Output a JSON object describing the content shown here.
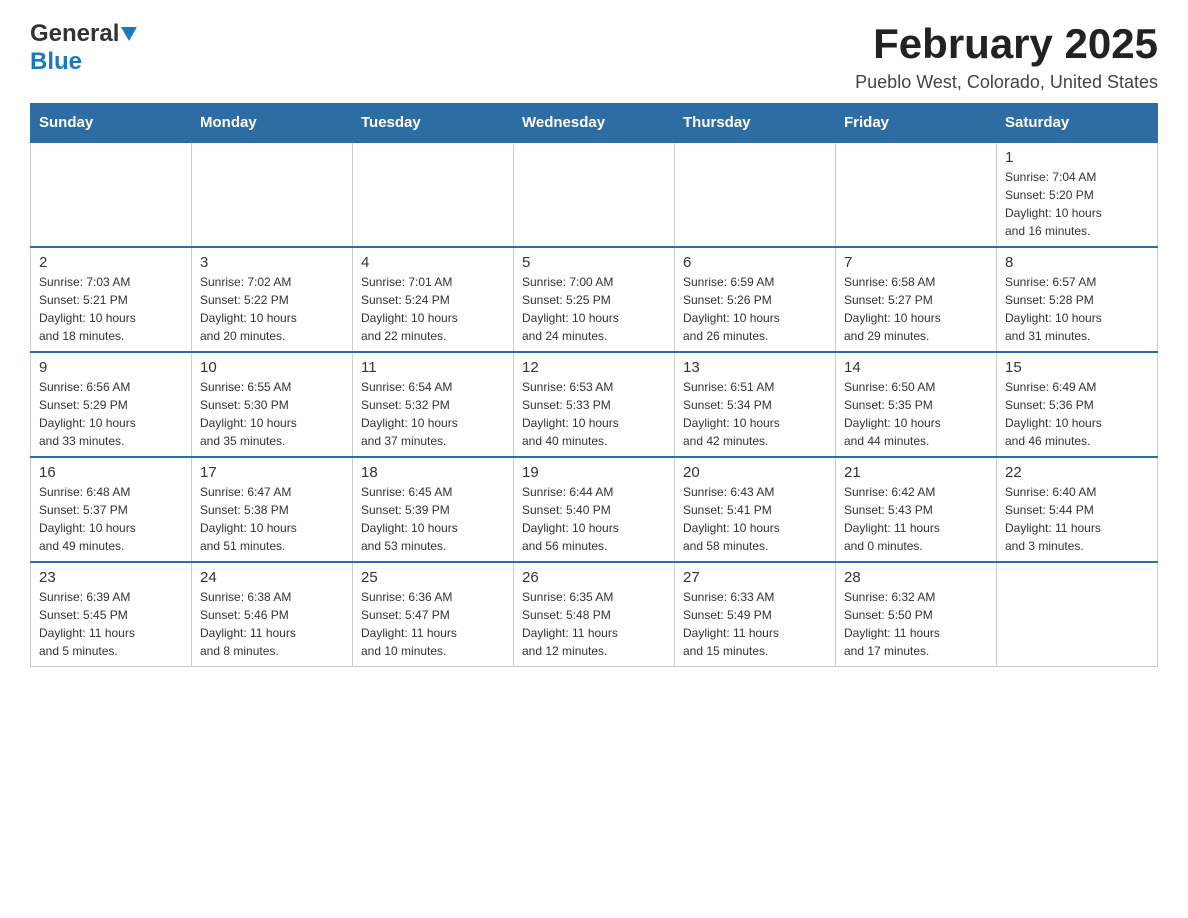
{
  "header": {
    "logo_general": "General",
    "logo_blue": "Blue",
    "month_title": "February 2025",
    "location": "Pueblo West, Colorado, United States"
  },
  "weekdays": [
    "Sunday",
    "Monday",
    "Tuesday",
    "Wednesday",
    "Thursday",
    "Friday",
    "Saturday"
  ],
  "weeks": [
    [
      {
        "day": "",
        "info": ""
      },
      {
        "day": "",
        "info": ""
      },
      {
        "day": "",
        "info": ""
      },
      {
        "day": "",
        "info": ""
      },
      {
        "day": "",
        "info": ""
      },
      {
        "day": "",
        "info": ""
      },
      {
        "day": "1",
        "info": "Sunrise: 7:04 AM\nSunset: 5:20 PM\nDaylight: 10 hours\nand 16 minutes."
      }
    ],
    [
      {
        "day": "2",
        "info": "Sunrise: 7:03 AM\nSunset: 5:21 PM\nDaylight: 10 hours\nand 18 minutes."
      },
      {
        "day": "3",
        "info": "Sunrise: 7:02 AM\nSunset: 5:22 PM\nDaylight: 10 hours\nand 20 minutes."
      },
      {
        "day": "4",
        "info": "Sunrise: 7:01 AM\nSunset: 5:24 PM\nDaylight: 10 hours\nand 22 minutes."
      },
      {
        "day": "5",
        "info": "Sunrise: 7:00 AM\nSunset: 5:25 PM\nDaylight: 10 hours\nand 24 minutes."
      },
      {
        "day": "6",
        "info": "Sunrise: 6:59 AM\nSunset: 5:26 PM\nDaylight: 10 hours\nand 26 minutes."
      },
      {
        "day": "7",
        "info": "Sunrise: 6:58 AM\nSunset: 5:27 PM\nDaylight: 10 hours\nand 29 minutes."
      },
      {
        "day": "8",
        "info": "Sunrise: 6:57 AM\nSunset: 5:28 PM\nDaylight: 10 hours\nand 31 minutes."
      }
    ],
    [
      {
        "day": "9",
        "info": "Sunrise: 6:56 AM\nSunset: 5:29 PM\nDaylight: 10 hours\nand 33 minutes."
      },
      {
        "day": "10",
        "info": "Sunrise: 6:55 AM\nSunset: 5:30 PM\nDaylight: 10 hours\nand 35 minutes."
      },
      {
        "day": "11",
        "info": "Sunrise: 6:54 AM\nSunset: 5:32 PM\nDaylight: 10 hours\nand 37 minutes."
      },
      {
        "day": "12",
        "info": "Sunrise: 6:53 AM\nSunset: 5:33 PM\nDaylight: 10 hours\nand 40 minutes."
      },
      {
        "day": "13",
        "info": "Sunrise: 6:51 AM\nSunset: 5:34 PM\nDaylight: 10 hours\nand 42 minutes."
      },
      {
        "day": "14",
        "info": "Sunrise: 6:50 AM\nSunset: 5:35 PM\nDaylight: 10 hours\nand 44 minutes."
      },
      {
        "day": "15",
        "info": "Sunrise: 6:49 AM\nSunset: 5:36 PM\nDaylight: 10 hours\nand 46 minutes."
      }
    ],
    [
      {
        "day": "16",
        "info": "Sunrise: 6:48 AM\nSunset: 5:37 PM\nDaylight: 10 hours\nand 49 minutes."
      },
      {
        "day": "17",
        "info": "Sunrise: 6:47 AM\nSunset: 5:38 PM\nDaylight: 10 hours\nand 51 minutes."
      },
      {
        "day": "18",
        "info": "Sunrise: 6:45 AM\nSunset: 5:39 PM\nDaylight: 10 hours\nand 53 minutes."
      },
      {
        "day": "19",
        "info": "Sunrise: 6:44 AM\nSunset: 5:40 PM\nDaylight: 10 hours\nand 56 minutes."
      },
      {
        "day": "20",
        "info": "Sunrise: 6:43 AM\nSunset: 5:41 PM\nDaylight: 10 hours\nand 58 minutes."
      },
      {
        "day": "21",
        "info": "Sunrise: 6:42 AM\nSunset: 5:43 PM\nDaylight: 11 hours\nand 0 minutes."
      },
      {
        "day": "22",
        "info": "Sunrise: 6:40 AM\nSunset: 5:44 PM\nDaylight: 11 hours\nand 3 minutes."
      }
    ],
    [
      {
        "day": "23",
        "info": "Sunrise: 6:39 AM\nSunset: 5:45 PM\nDaylight: 11 hours\nand 5 minutes."
      },
      {
        "day": "24",
        "info": "Sunrise: 6:38 AM\nSunset: 5:46 PM\nDaylight: 11 hours\nand 8 minutes."
      },
      {
        "day": "25",
        "info": "Sunrise: 6:36 AM\nSunset: 5:47 PM\nDaylight: 11 hours\nand 10 minutes."
      },
      {
        "day": "26",
        "info": "Sunrise: 6:35 AM\nSunset: 5:48 PM\nDaylight: 11 hours\nand 12 minutes."
      },
      {
        "day": "27",
        "info": "Sunrise: 6:33 AM\nSunset: 5:49 PM\nDaylight: 11 hours\nand 15 minutes."
      },
      {
        "day": "28",
        "info": "Sunrise: 6:32 AM\nSunset: 5:50 PM\nDaylight: 11 hours\nand 17 minutes."
      },
      {
        "day": "",
        "info": ""
      }
    ]
  ]
}
